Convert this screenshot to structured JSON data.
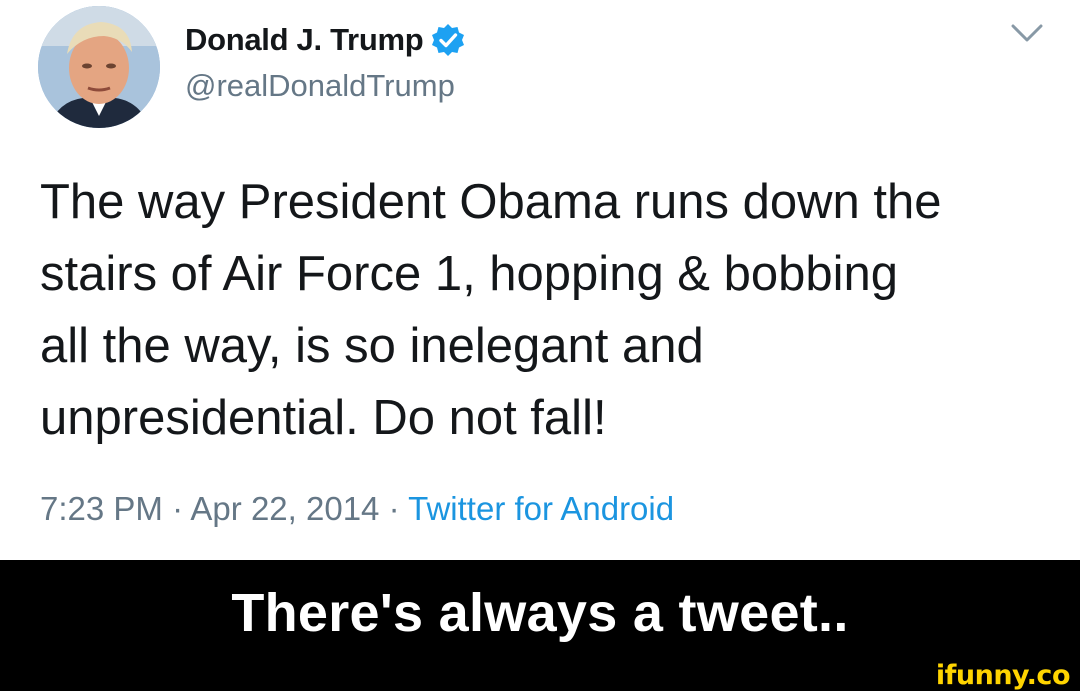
{
  "tweet": {
    "display_name": "Donald J. Trump",
    "handle": "@realDonaldTrump",
    "text": "The way President Obama runs down the\nstairs of Air Force 1, hopping & bobbing\nall the way, is so inelegant and\nunpresidential. Do not fall!",
    "time": "7:23 PM",
    "date": "Apr 22, 2014",
    "separator": " · ",
    "source": "Twitter for Android",
    "icons": {
      "verified": "verified-badge-icon",
      "menu": "chevron-down-icon"
    },
    "colors": {
      "verified": "#1da1f2",
      "source_link": "#1b95e0",
      "secondary_text": "#657786"
    }
  },
  "caption": {
    "text": "There's always a tweet..",
    "watermark": "ifunny.co"
  }
}
